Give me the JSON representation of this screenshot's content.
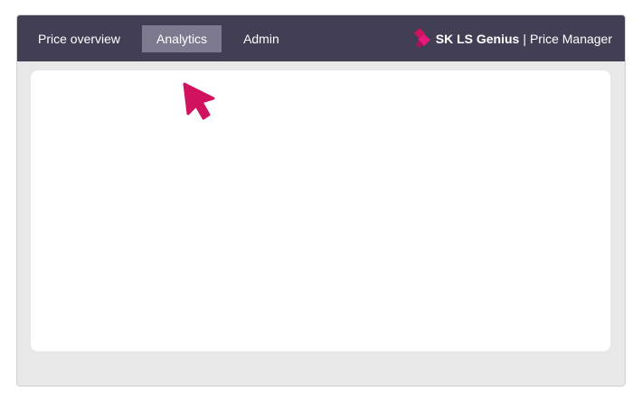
{
  "nav": {
    "items": [
      {
        "label": "Price overview"
      },
      {
        "label": "Analytics",
        "active": true
      },
      {
        "label": "Admin"
      }
    ]
  },
  "brand": {
    "name": "SK LS Genius",
    "separator": "|",
    "product": "Price Manager",
    "logo_icon": "diamond-logo-icon"
  },
  "colors": {
    "topbar": "#423e54",
    "active_tab": "#7d7a8f",
    "accent": "#d0125f",
    "background": "#e8e8e8"
  },
  "cursor": {
    "icon": "pointer-arrow-icon"
  }
}
